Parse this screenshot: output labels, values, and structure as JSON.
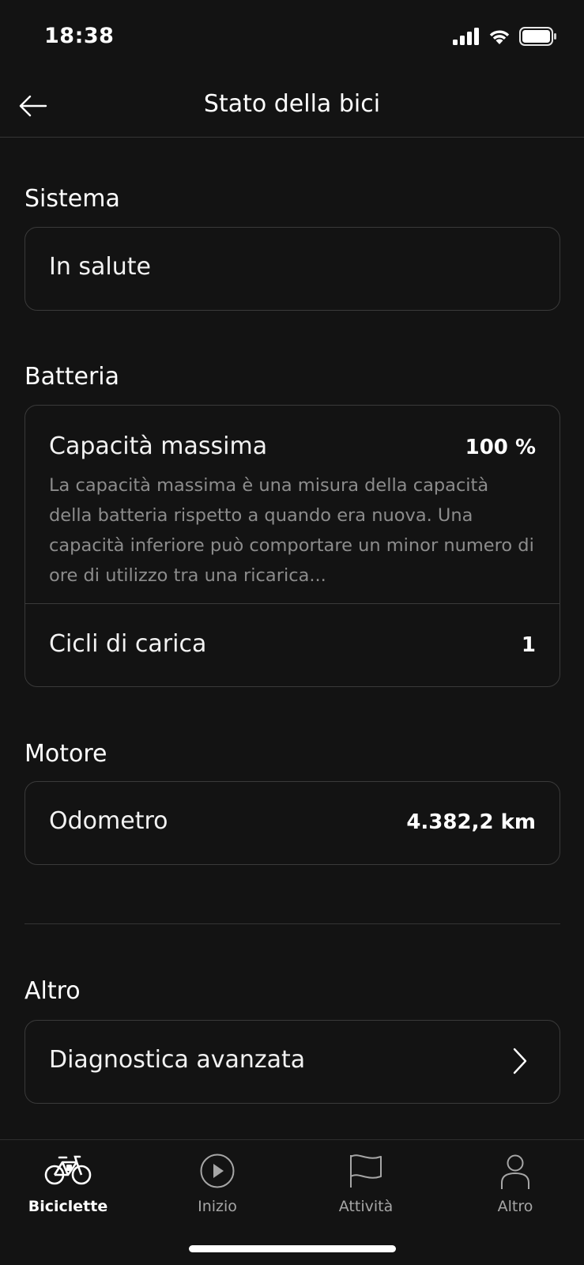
{
  "status_bar": {
    "time": "18:38"
  },
  "nav": {
    "title": "Stato della bici"
  },
  "sistema": {
    "title": "Sistema",
    "status": "In salute"
  },
  "batteria": {
    "title": "Batteria",
    "capacity_label": "Capacità massima",
    "capacity_value": "100 %",
    "capacity_desc": "La capacità massima è una misura della capacità della batteria rispetto a quando era nuova. Una capacità inferiore può comportare un minor numero di ore di utilizzo tra una ricarica...",
    "cycles_label": "Cicli di carica",
    "cycles_value": "1"
  },
  "motore": {
    "title": "Motore",
    "odometer_label": "Odometro",
    "odometer_value": "4.382,2 km"
  },
  "altro": {
    "title": "Altro",
    "diagnostics_label": "Diagnostica avanzata"
  },
  "tabs": [
    {
      "label": "Biciclette",
      "icon": "bicycle-icon",
      "active": true
    },
    {
      "label": "Inizio",
      "icon": "play-icon",
      "active": false
    },
    {
      "label": "Attività",
      "icon": "flag-icon",
      "active": false
    },
    {
      "label": "Altro",
      "icon": "person-icon",
      "active": false
    }
  ],
  "colors": {
    "background": "#131313",
    "border": "#3a3a3a",
    "muted_text": "#8c8c8c"
  }
}
